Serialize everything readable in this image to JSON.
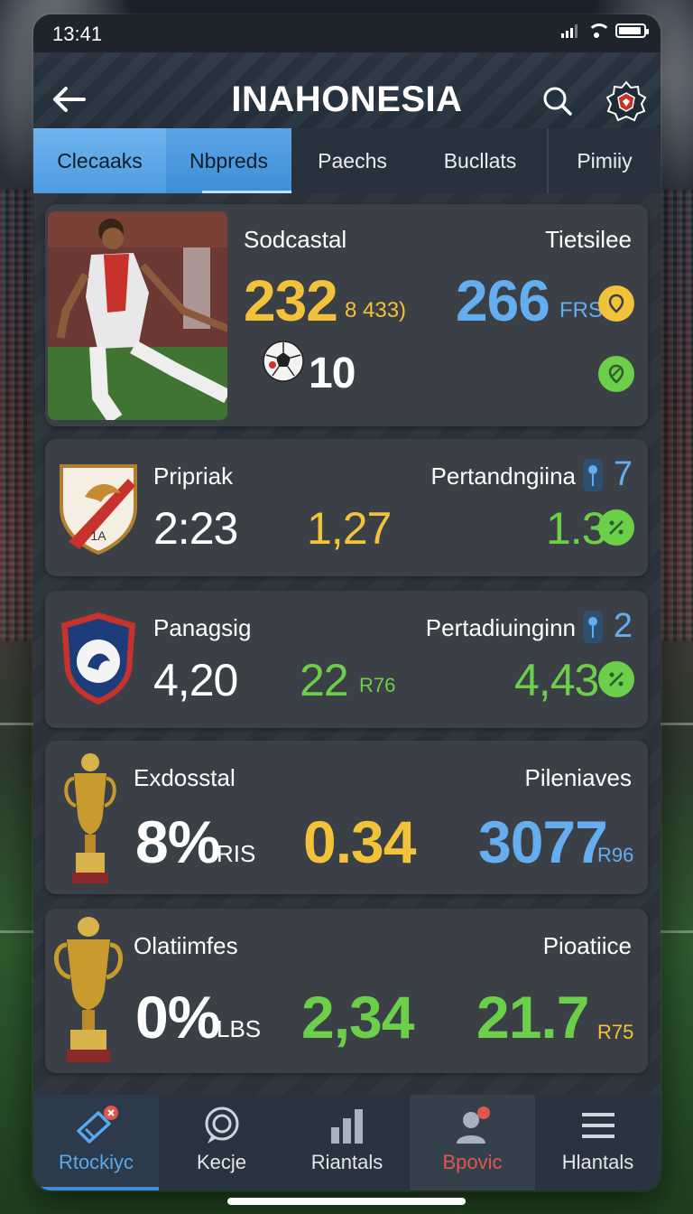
{
  "status_bar": {
    "time": "13:41"
  },
  "header": {
    "title": "INAHONESIA"
  },
  "tabs": [
    {
      "label": "Clecaaks"
    },
    {
      "label": "Nbpreds"
    },
    {
      "label": "Paechs"
    },
    {
      "label": "Bucllats"
    },
    {
      "label": "Pimiiy"
    }
  ],
  "cards": [
    {
      "left_label": "Sodcastal",
      "right_label": "Tietsilee",
      "value_a": "232",
      "value_a_sub": "8 433)",
      "value_b": "266",
      "value_b_sub": "FRS",
      "value_c": "10"
    },
    {
      "left_label": "Pripriak",
      "right_label": "Pertandngiina",
      "right_count": "7",
      "value_a": "2:23",
      "value_b": "1,27",
      "value_c": "1.3"
    },
    {
      "left_label": "Panagsig",
      "right_label": "Pertadiuinginn",
      "right_count": "2",
      "value_a": "4,20",
      "value_b": "22",
      "value_b_sub": "R76",
      "value_c": "4,43"
    },
    {
      "left_label": "Exdosstal",
      "right_label": "Pileniaves",
      "value_a": "8%",
      "value_a_sub": "RIS",
      "value_b": "0.34",
      "value_c": "3077",
      "value_c_sub": "R96"
    },
    {
      "left_label": "Olatiimfes",
      "right_label": "Pioatiice",
      "value_a": "0%",
      "value_a_sub": "LBS",
      "value_b": "2,34",
      "value_c": "21.7",
      "value_c_sub": "R75"
    }
  ],
  "bottom_nav": [
    {
      "label": "Rtockiyc",
      "icon": "ticket-icon"
    },
    {
      "label": "Kecje",
      "icon": "chat-icon"
    },
    {
      "label": "Riantals",
      "icon": "bar-chart-icon"
    },
    {
      "label": "Bpovic",
      "icon": "profile-icon"
    },
    {
      "label": "Hlantals",
      "icon": "menu-icon"
    }
  ],
  "colors": {
    "accent_blue": "#4e9ce0",
    "value_yellow": "#f2c23a",
    "value_blue": "#64aef0",
    "value_green": "#6ccf4a",
    "alert_red": "#e0564a"
  }
}
